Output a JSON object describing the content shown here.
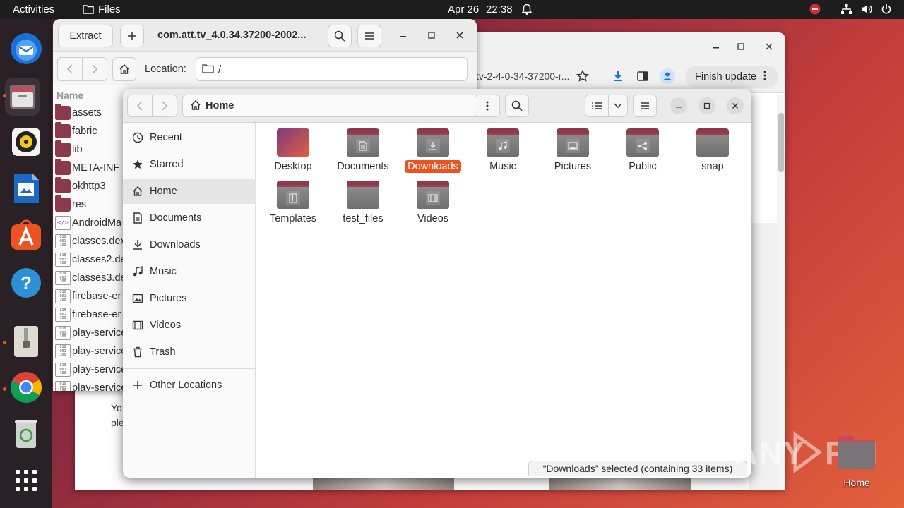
{
  "topbar": {
    "activities": "Activities",
    "app_name": "Files",
    "date": "Apr 26",
    "time": "22:38"
  },
  "dock": {
    "items": [
      "thunderbird-icon",
      "files-icon",
      "rhythmbox-icon",
      "libreoffice-writer-icon",
      "app-center-icon",
      "help-icon",
      "archive-manager-icon",
      "chrome-icon",
      "trash-icon",
      "show-apps-icon"
    ]
  },
  "browser": {
    "url_fragment": "tv-2-4-0-34-37200-r...",
    "finish_update": "Finish update",
    "body_text_1": "Yo",
    "body_text_2": "ple"
  },
  "archive": {
    "extract_label": "Extract",
    "title": "com.att.tv_4.0.34.37200-2002...",
    "location_label": "Location:",
    "location_value": "/",
    "column_name": "Name",
    "files": [
      {
        "name": "assets",
        "type": "folder"
      },
      {
        "name": "fabric",
        "type": "folder"
      },
      {
        "name": "lib",
        "type": "folder"
      },
      {
        "name": "META-INF",
        "type": "folder"
      },
      {
        "name": "okhttp3",
        "type": "folder"
      },
      {
        "name": "res",
        "type": "folder"
      },
      {
        "name": "AndroidMa",
        "type": "xml"
      },
      {
        "name": "classes.dex",
        "type": "binary"
      },
      {
        "name": "classes2.de",
        "type": "binary"
      },
      {
        "name": "classes3.de",
        "type": "binary"
      },
      {
        "name": "firebase-er",
        "type": "binary"
      },
      {
        "name": "firebase-er",
        "type": "binary"
      },
      {
        "name": "play-service",
        "type": "binary"
      },
      {
        "name": "play-service",
        "type": "binary"
      },
      {
        "name": "play-service",
        "type": "binary"
      },
      {
        "name": "play-service",
        "type": "binary"
      }
    ]
  },
  "files": {
    "path": "Home",
    "sidebar": [
      {
        "label": "Recent",
        "icon": "clock-icon"
      },
      {
        "label": "Starred",
        "icon": "star-icon"
      },
      {
        "label": "Home",
        "icon": "home-icon",
        "active": true
      },
      {
        "label": "Documents",
        "icon": "document-icon"
      },
      {
        "label": "Downloads",
        "icon": "download-icon"
      },
      {
        "label": "Music",
        "icon": "music-icon"
      },
      {
        "label": "Pictures",
        "icon": "picture-icon"
      },
      {
        "label": "Videos",
        "icon": "video-icon"
      },
      {
        "label": "Trash",
        "icon": "trash-icon"
      },
      {
        "label": "Other Locations",
        "icon": "plus-icon"
      }
    ],
    "folders": [
      {
        "label": "Desktop",
        "icon": "desktop-folder-icon"
      },
      {
        "label": "Documents",
        "icon": "documents-folder-icon"
      },
      {
        "label": "Downloads",
        "icon": "downloads-folder-icon",
        "selected": true
      },
      {
        "label": "Music",
        "icon": "music-folder-icon"
      },
      {
        "label": "Pictures",
        "icon": "pictures-folder-icon"
      },
      {
        "label": "Public",
        "icon": "public-folder-icon"
      },
      {
        "label": "snap",
        "icon": "folder-icon"
      },
      {
        "label": "Templates",
        "icon": "templates-folder-icon"
      },
      {
        "label": "test_files",
        "icon": "folder-icon"
      },
      {
        "label": "Videos",
        "icon": "videos-folder-icon"
      }
    ],
    "status": "“Downloads” selected  (containing 33 items)"
  },
  "desktop": {
    "home_label": "Home",
    "watermark": "ANY RUN"
  },
  "colors": {
    "accent": "#e95420",
    "folder": "#8c3a4b",
    "topbar": "#1d1d1d",
    "dock": "#2a2126"
  }
}
